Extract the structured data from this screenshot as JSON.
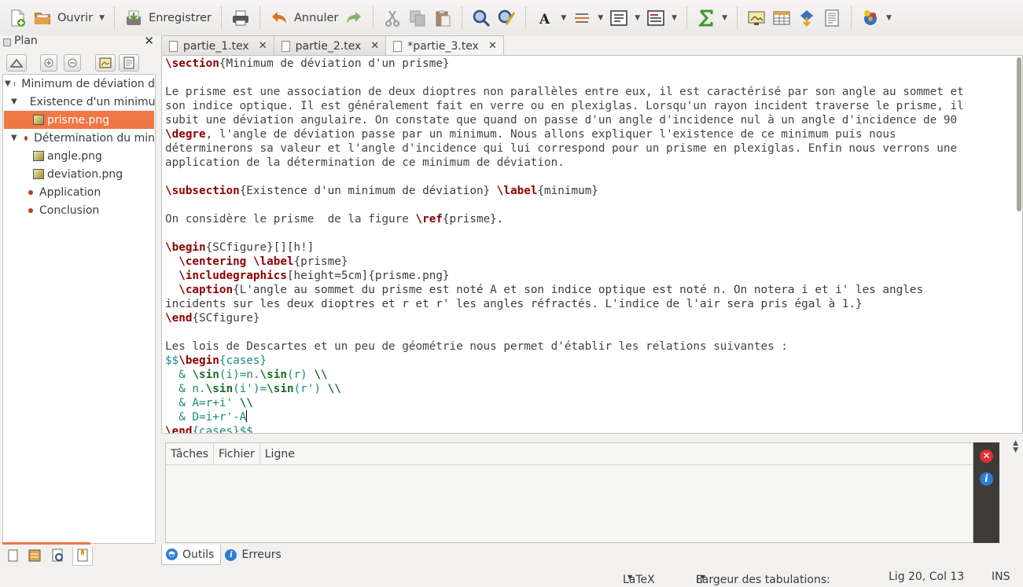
{
  "toolbar": {
    "open_label": "Ouvrir",
    "save_label": "Enregistrer",
    "undo_label": "Annuler"
  },
  "sidebar": {
    "title": "Plan",
    "tree": [
      {
        "label": "Minimum de déviation d",
        "level": 0,
        "kind": "section",
        "expanded": true
      },
      {
        "label": "Existence d'un minimu",
        "level": 1,
        "kind": "section",
        "expanded": true
      },
      {
        "label": "prisme.png",
        "level": 2,
        "kind": "image",
        "selected": true
      },
      {
        "label": "Détermination du min",
        "level": 1,
        "kind": "section",
        "expanded": true
      },
      {
        "label": "angle.png",
        "level": 2,
        "kind": "image"
      },
      {
        "label": "deviation.png",
        "level": 2,
        "kind": "image"
      },
      {
        "label": "Application",
        "level": 1,
        "kind": "section"
      },
      {
        "label": "Conclusion",
        "level": 1,
        "kind": "section"
      }
    ]
  },
  "tabs": [
    {
      "label": "partie_1.tex",
      "active": false
    },
    {
      "label": "partie_2.tex",
      "active": false
    },
    {
      "label": "*partie_3.tex",
      "active": true
    }
  ],
  "editor": {
    "lines": [
      [
        [
          "c",
          "\\section"
        ],
        [
          "a",
          "{Minimum de déviation d'un prisme}"
        ]
      ],
      [],
      [
        [
          "t",
          "Le prisme est une association de deux dioptres non parallèles entre eux, il est caractérisé par son angle au sommet et"
        ]
      ],
      [
        [
          "t",
          "son indice optique. Il est généralement fait en verre ou en plexiglas. Lorsqu'un rayon incident traverse le prisme, il"
        ]
      ],
      [
        [
          "t",
          "subit une déviation angulaire. On constate que quand on passe d'un angle d'incidence nul à un angle d'incidence de 90"
        ]
      ],
      [
        [
          "c",
          "\\degre"
        ],
        [
          "t",
          ", l'angle de déviation passe par un minimum. Nous allons expliquer l'existence de ce minimum puis nous"
        ]
      ],
      [
        [
          "t",
          "déterminerons sa valeur et l'angle d'incidence qui lui correspond pour un prisme en plexiglas. Enfin nous verrons une"
        ]
      ],
      [
        [
          "t",
          "application de la détermination de ce minimum de déviation."
        ]
      ],
      [],
      [
        [
          "c",
          "\\subsection"
        ],
        [
          "a",
          "{Existence d'un minimum de déviation}"
        ],
        [
          "t",
          " "
        ],
        [
          "c",
          "\\label"
        ],
        [
          "a",
          "{minimum}"
        ]
      ],
      [],
      [
        [
          "t",
          "On considère le prisme  de la figure "
        ],
        [
          "c",
          "\\ref"
        ],
        [
          "a",
          "{prisme}"
        ],
        [
          "t",
          "."
        ]
      ],
      [],
      [
        [
          "c",
          "\\begin"
        ],
        [
          "a",
          "{SCfigure}[][h!]"
        ]
      ],
      [
        [
          "t",
          "  "
        ],
        [
          "c",
          "\\centering"
        ],
        [
          "t",
          " "
        ],
        [
          "c",
          "\\label"
        ],
        [
          "a",
          "{prisme}"
        ]
      ],
      [
        [
          "t",
          "  "
        ],
        [
          "c",
          "\\includegraphics"
        ],
        [
          "a",
          "[height=5cm]{prisme.png}"
        ]
      ],
      [
        [
          "t",
          "  "
        ],
        [
          "c",
          "\\caption"
        ],
        [
          "a",
          "{L'angle au sommet du prisme est noté A et son indice optique est noté n. On notera i et i' les angles"
        ]
      ],
      [
        [
          "a",
          "incidents sur les deux dioptres et r et r' les angles réfractés. L'indice de l'air sera pris égal à 1.}"
        ]
      ],
      [
        [
          "c",
          "\\end"
        ],
        [
          "a",
          "{SCfigure}"
        ]
      ],
      [],
      [
        [
          "t",
          "Les lois de Descartes et un peu de géométrie nous permet d'établir les relations suivantes :"
        ]
      ],
      [
        [
          "m",
          "$$"
        ],
        [
          "c",
          "\\begin"
        ],
        [
          "m",
          "{cases}"
        ]
      ],
      [
        [
          "m",
          "  & "
        ],
        [
          "g",
          "\\sin"
        ],
        [
          "m",
          "(i)=n."
        ],
        [
          "g",
          "\\sin"
        ],
        [
          "m",
          "(r) "
        ],
        [
          "g",
          "\\\\"
        ]
      ],
      [
        [
          "m",
          "  & n."
        ],
        [
          "g",
          "\\sin"
        ],
        [
          "m",
          "(i')="
        ],
        [
          "g",
          "\\sin"
        ],
        [
          "m",
          "(r') "
        ],
        [
          "g",
          "\\\\"
        ]
      ],
      [
        [
          "m",
          "  & A=r+i' "
        ],
        [
          "g",
          "\\\\"
        ]
      ],
      [
        [
          "m",
          "  & D=i+r'-A"
        ],
        [
          "k",
          ""
        ]
      ],
      [
        [
          "c",
          "\\end"
        ],
        [
          "m",
          "{cases}$$"
        ]
      ]
    ]
  },
  "bottom_panel": {
    "columns": [
      "Tâches",
      "Fichier",
      "Ligne"
    ],
    "tabs": [
      {
        "label": "Outils",
        "active": true
      },
      {
        "label": "Erreurs",
        "active": false
      }
    ]
  },
  "statusbar": {
    "mode": "LaTeX",
    "tab_width_label": "Largeur des tabulations:",
    "tab_width_value": "8",
    "position": "Lig 20, Col 13",
    "insert_mode": "INS"
  },
  "colors": {
    "selection": "#f07746",
    "command": "#8b0000",
    "math": "#1c8a79",
    "math_command": "#1b6e25"
  }
}
